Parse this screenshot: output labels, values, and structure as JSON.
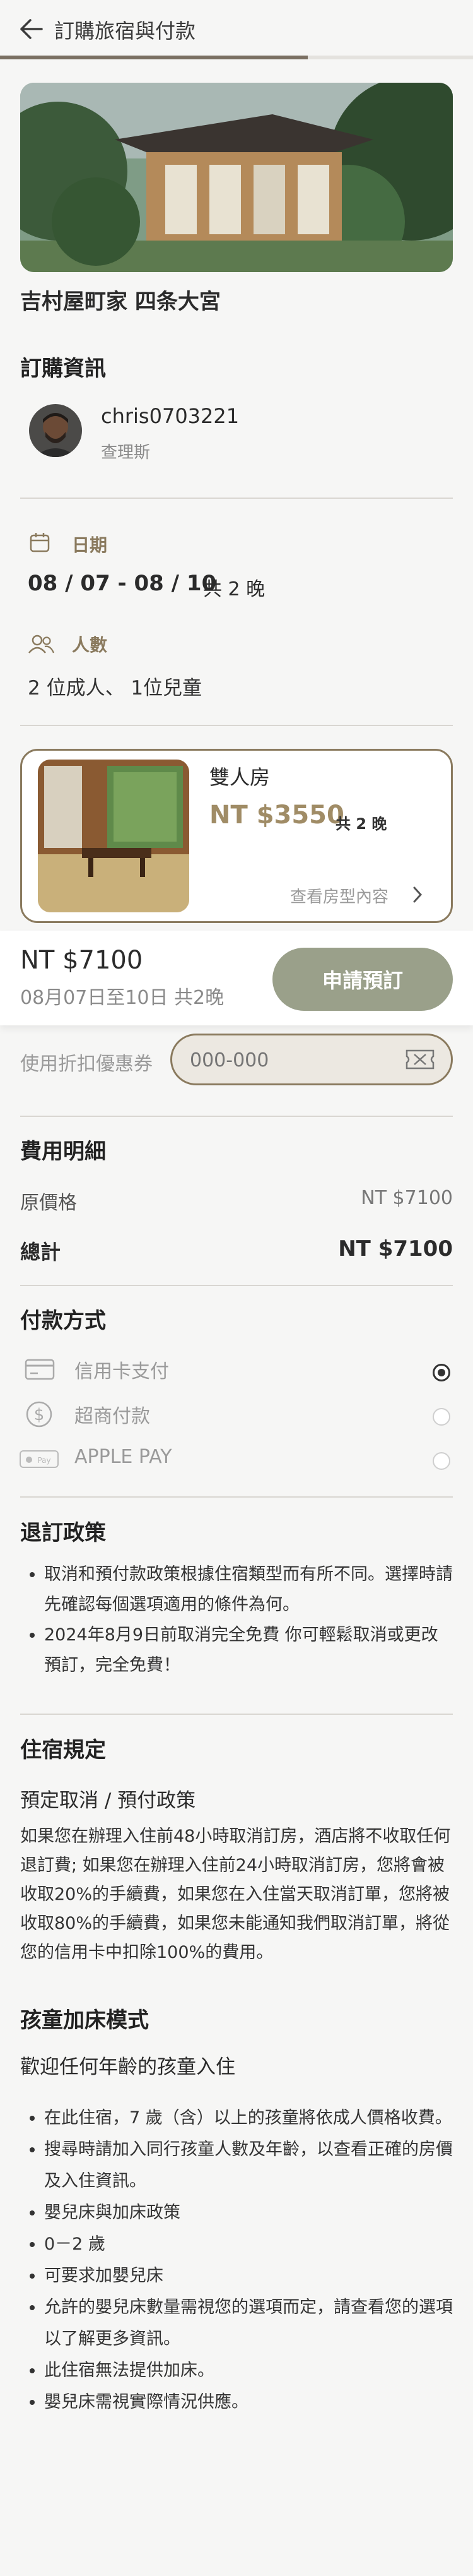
{
  "header": {
    "title": "訂購旅宿與付款",
    "progress": 0.65
  },
  "hotel": {
    "name": "吉村屋町家 四条大宮"
  },
  "booking_info": {
    "title": "訂購資訊",
    "user": {
      "name": "chris0703221",
      "sub": "查理斯"
    },
    "date_label": "日期",
    "date_value": "08 / 07 - 08 / 10",
    "nights": "共 2 晚",
    "people_label": "人數",
    "people_value": "2 位成人、 1位兒童"
  },
  "room": {
    "name": "雙人房",
    "price": "NT $3550",
    "nights": "共 2 晚",
    "detail_link": "查看房型內容"
  },
  "booking_bar": {
    "total": "NT $7100",
    "dates": "08月07日至10日 共2晚",
    "button": "申請預訂"
  },
  "coupon": {
    "label": "使用折扣優惠券",
    "placeholder": "000-000"
  },
  "fees": {
    "title": "費用明細",
    "original_label": "原價格",
    "original_value": "NT $7100",
    "total_label": "總計",
    "total_value": "NT $7100"
  },
  "payment": {
    "title": "付款方式",
    "options": [
      {
        "label": "信用卡支付",
        "icon": "credit-card-icon",
        "selected": true
      },
      {
        "label": "超商付款",
        "icon": "dollar-icon",
        "selected": false
      },
      {
        "label": "APPLE PAY",
        "icon": "apple-pay-icon",
        "selected": false
      }
    ]
  },
  "policy": {
    "title": "退訂政策",
    "items": [
      "取消和預付款政策根據住宿類型而有所不同。選擇時請先確認每個選項適用的條件為何。",
      "2024年8月9日前取消完全免費 你可輕鬆取消或更改預訂，完全免費！"
    ]
  },
  "rules": {
    "title": "住宿規定",
    "cancel_subtitle": "預定取消 / 預付政策",
    "cancel_text": "如果您在辦理入住前48小時取消訂房，酒店將不收取任何退訂費; 如果您在辦理入住前24小時取消訂房，您將會被收取20%的手續費，如果您在入住當天取消訂單，您將被收取80%的手續費，如果您未能通知我們取消訂單，將從您的信用卡中扣除100%的費用。",
    "child_title": "孩童加床模式",
    "child_subtitle": "歡迎任何年齡的孩童入住",
    "child_items": [
      "在此住宿，7 歲（含）以上的孩童將依成人價格收費。",
      "搜尋時請加入同行孩童人數及年齡，以查看正確的房價及入住資訊。",
      "嬰兒床與加床政策",
      "0－2 歲",
      "可要求加嬰兒床",
      "允許的嬰兒床數量需視您的選項而定，請查看您的選項以了解更多資訊。",
      "此住宿無法提供加床。",
      "嬰兒床需視實際情況供應。"
    ]
  },
  "colors": {
    "accent": "#8a7a5e",
    "button": "#9aa08a",
    "background": "#f6f6f5"
  }
}
